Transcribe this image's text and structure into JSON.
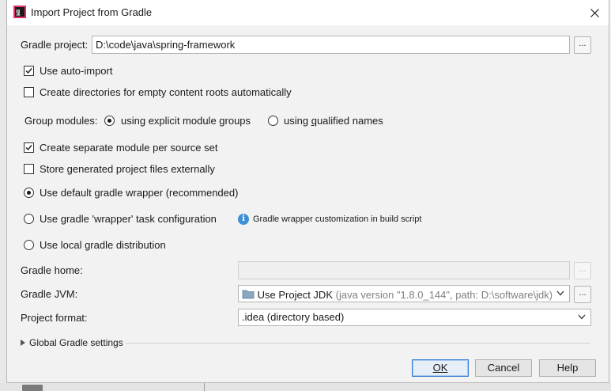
{
  "dialog": {
    "title": "Import Project from Gradle"
  },
  "gradle_project": {
    "label": "Gradle project:",
    "value": "D:\\code\\java\\spring-framework",
    "browse_label": "..."
  },
  "options": {
    "auto_import": {
      "label": "Use auto-import",
      "checked": true
    },
    "create_dirs": {
      "label": "Create directories for empty content roots automatically",
      "checked": false
    }
  },
  "group_modules": {
    "label": "Group modules:",
    "explicit": {
      "label": "using explicit module groups",
      "selected": true
    },
    "qualified": {
      "label_prefix": "using ",
      "label_mnemonic": "q",
      "label_suffix": "ualified names",
      "selected": false
    }
  },
  "module_options": {
    "separate_per_source_set": {
      "label": "Create separate module per source set",
      "checked": true
    },
    "store_externally": {
      "label": "Store generated project files externally",
      "checked": false
    }
  },
  "distribution": {
    "default_wrapper": {
      "label": "Use default gradle wrapper (recommended)",
      "selected": true
    },
    "wrapper_task": {
      "label": "Use gradle 'wrapper' task configuration",
      "selected": false
    },
    "wrapper_hint": "Gradle wrapper customization in build script",
    "local": {
      "label": "Use local gradle distribution",
      "selected": false
    }
  },
  "gradle_home": {
    "label": "Gradle home:",
    "value": "",
    "browse_label": "..."
  },
  "gradle_jvm": {
    "label": "Gradle JVM:",
    "selected_main": "Use Project JDK",
    "selected_detail": "(java version \"1.8.0_144\", path: D:\\software\\jdk)",
    "browse_label": "..."
  },
  "project_format": {
    "label": "Project format:",
    "selected": ".idea (directory based)"
  },
  "global_settings": {
    "label": "Global Gradle settings"
  },
  "buttons": {
    "ok": "OK",
    "cancel": "Cancel",
    "help": "Help"
  },
  "colors": {
    "accent": "#2c7bd1",
    "info": "#3d8fd6"
  }
}
